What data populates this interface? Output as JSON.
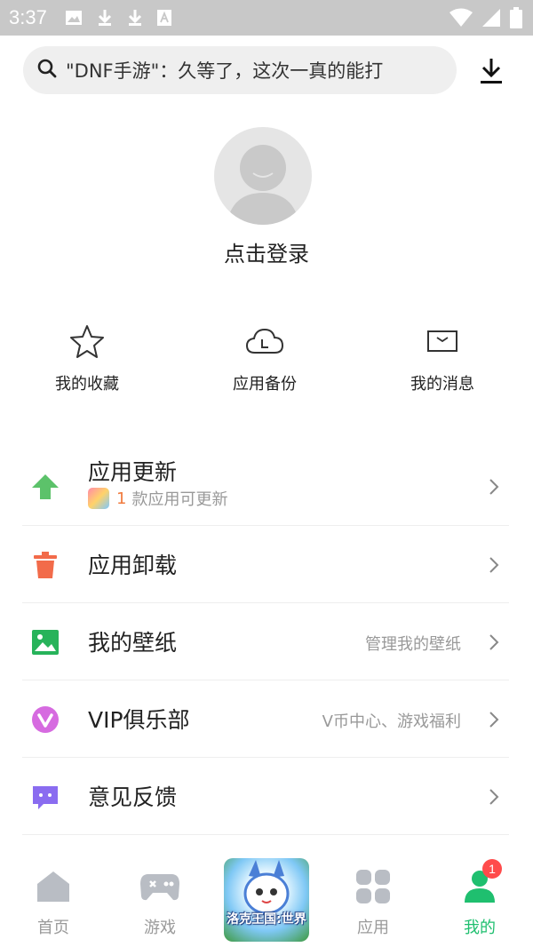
{
  "status_bar": {
    "time": "3:37"
  },
  "search": {
    "query": "\"DNF手游\"：久等了，这次一真的能打"
  },
  "profile": {
    "login_label": "点击登录"
  },
  "quick_actions": [
    {
      "label": "我的收藏",
      "icon": "star-icon"
    },
    {
      "label": "应用备份",
      "icon": "cloud-icon"
    },
    {
      "label": "我的消息",
      "icon": "mail-icon"
    }
  ],
  "menu": {
    "update": {
      "title": "应用更新",
      "count": "1",
      "sub": "款应用可更新"
    },
    "uninstall": {
      "title": "应用卸载"
    },
    "wallpaper": {
      "title": "我的壁纸",
      "hint": "管理我的壁纸"
    },
    "vip": {
      "title": "VIP俱乐部",
      "hint": "V币中心、游戏福利"
    },
    "feedback": {
      "title": "意见反馈"
    }
  },
  "bottom_nav": {
    "tabs": [
      {
        "label": "首页",
        "active": false
      },
      {
        "label": "游戏",
        "active": false
      },
      {
        "label": "应用",
        "active": false
      },
      {
        "label": "我的",
        "active": true
      }
    ],
    "promo_text": "洛克王国:世界",
    "badge_count": "1"
  },
  "colors": {
    "accent": "#1fbf6f",
    "update_green": "#5cc26a",
    "uninstall_orange": "#f26b4a",
    "wallpaper_green": "#27b35a",
    "vip_purple": "#d66be0",
    "feedback_purple": "#8a6cf0"
  }
}
